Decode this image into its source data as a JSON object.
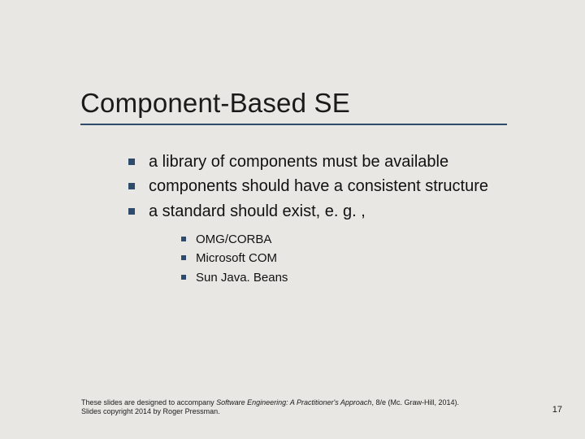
{
  "slide": {
    "title": "Component-Based SE",
    "bullets": [
      {
        "text": "a library of components must be available"
      },
      {
        "text": "components should have a consistent structure"
      },
      {
        "text": "a standard should exist, e. g. ,"
      }
    ],
    "sub_bullets": [
      {
        "text": "OMG/CORBA"
      },
      {
        "text": "Microsoft COM"
      },
      {
        "text": "Sun Java. Beans"
      }
    ],
    "footer_prefix": "These slides are designed to accompany ",
    "footer_italic": "Software Engineering: A Practitioner's Approach",
    "footer_suffix": ", 8/e (Mc. Graw-Hill, 2014). Slides copyright 2014 by Roger Pressman.",
    "page_number": "17"
  }
}
